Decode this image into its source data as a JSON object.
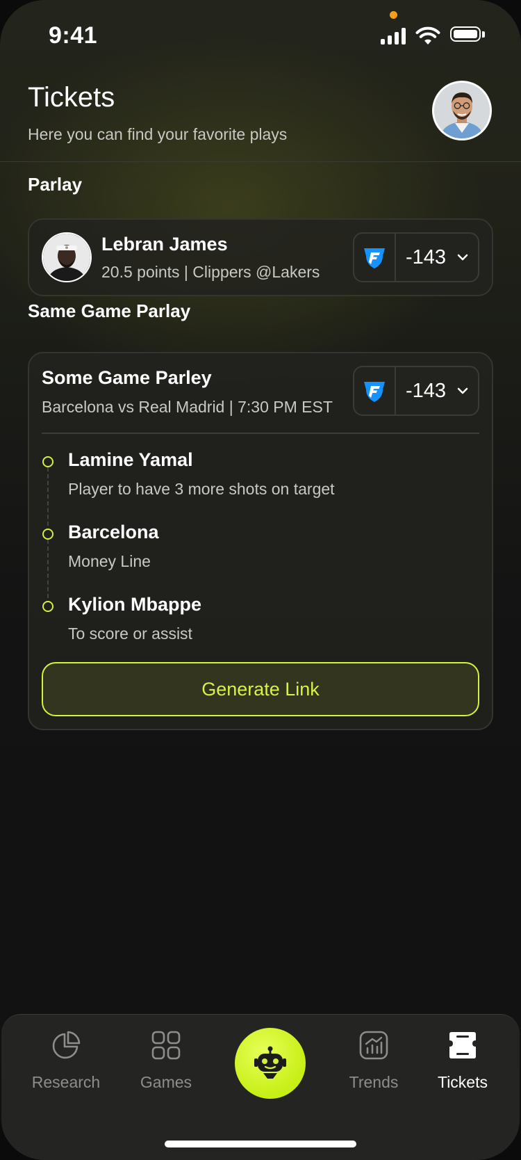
{
  "status_bar": {
    "time": "9:41"
  },
  "header": {
    "title": "Tickets",
    "subtitle": "Here you can find your favorite plays"
  },
  "parlay": {
    "section_label": "Parlay",
    "player_name": "Lebran James",
    "detail": "20.5 points | Clippers @Lakers",
    "odds": "-143",
    "sportsbook_icon": "fanduel-logo-icon"
  },
  "same_game_parlay": {
    "section_label": "Same Game Parlay",
    "title": "Some Game Parley",
    "detail": "Barcelona vs Real Madrid | 7:30 PM EST",
    "odds": "-143",
    "legs": [
      {
        "name": "Lamine Yamal",
        "desc": "Player to have 3 more shots on target"
      },
      {
        "name": "Barcelona",
        "desc": "Money Line"
      },
      {
        "name": "Kylion Mbappe",
        "desc": "To score or assist"
      }
    ],
    "button_label": "Generate Link"
  },
  "tabbar": {
    "tabs": [
      {
        "label": "Research",
        "icon": "pie-chart-icon"
      },
      {
        "label": "Games",
        "icon": "grid-icon"
      },
      {
        "label": "",
        "icon": "robot-icon"
      },
      {
        "label": "Trends",
        "icon": "trend-chart-icon"
      },
      {
        "label": "Tickets",
        "icon": "ticket-icon"
      }
    ],
    "active": "Tickets"
  },
  "colors": {
    "accent": "#d4ef3c",
    "background": "#111111",
    "card": "#22221e",
    "sportsbook_blue": "#1493ff"
  }
}
